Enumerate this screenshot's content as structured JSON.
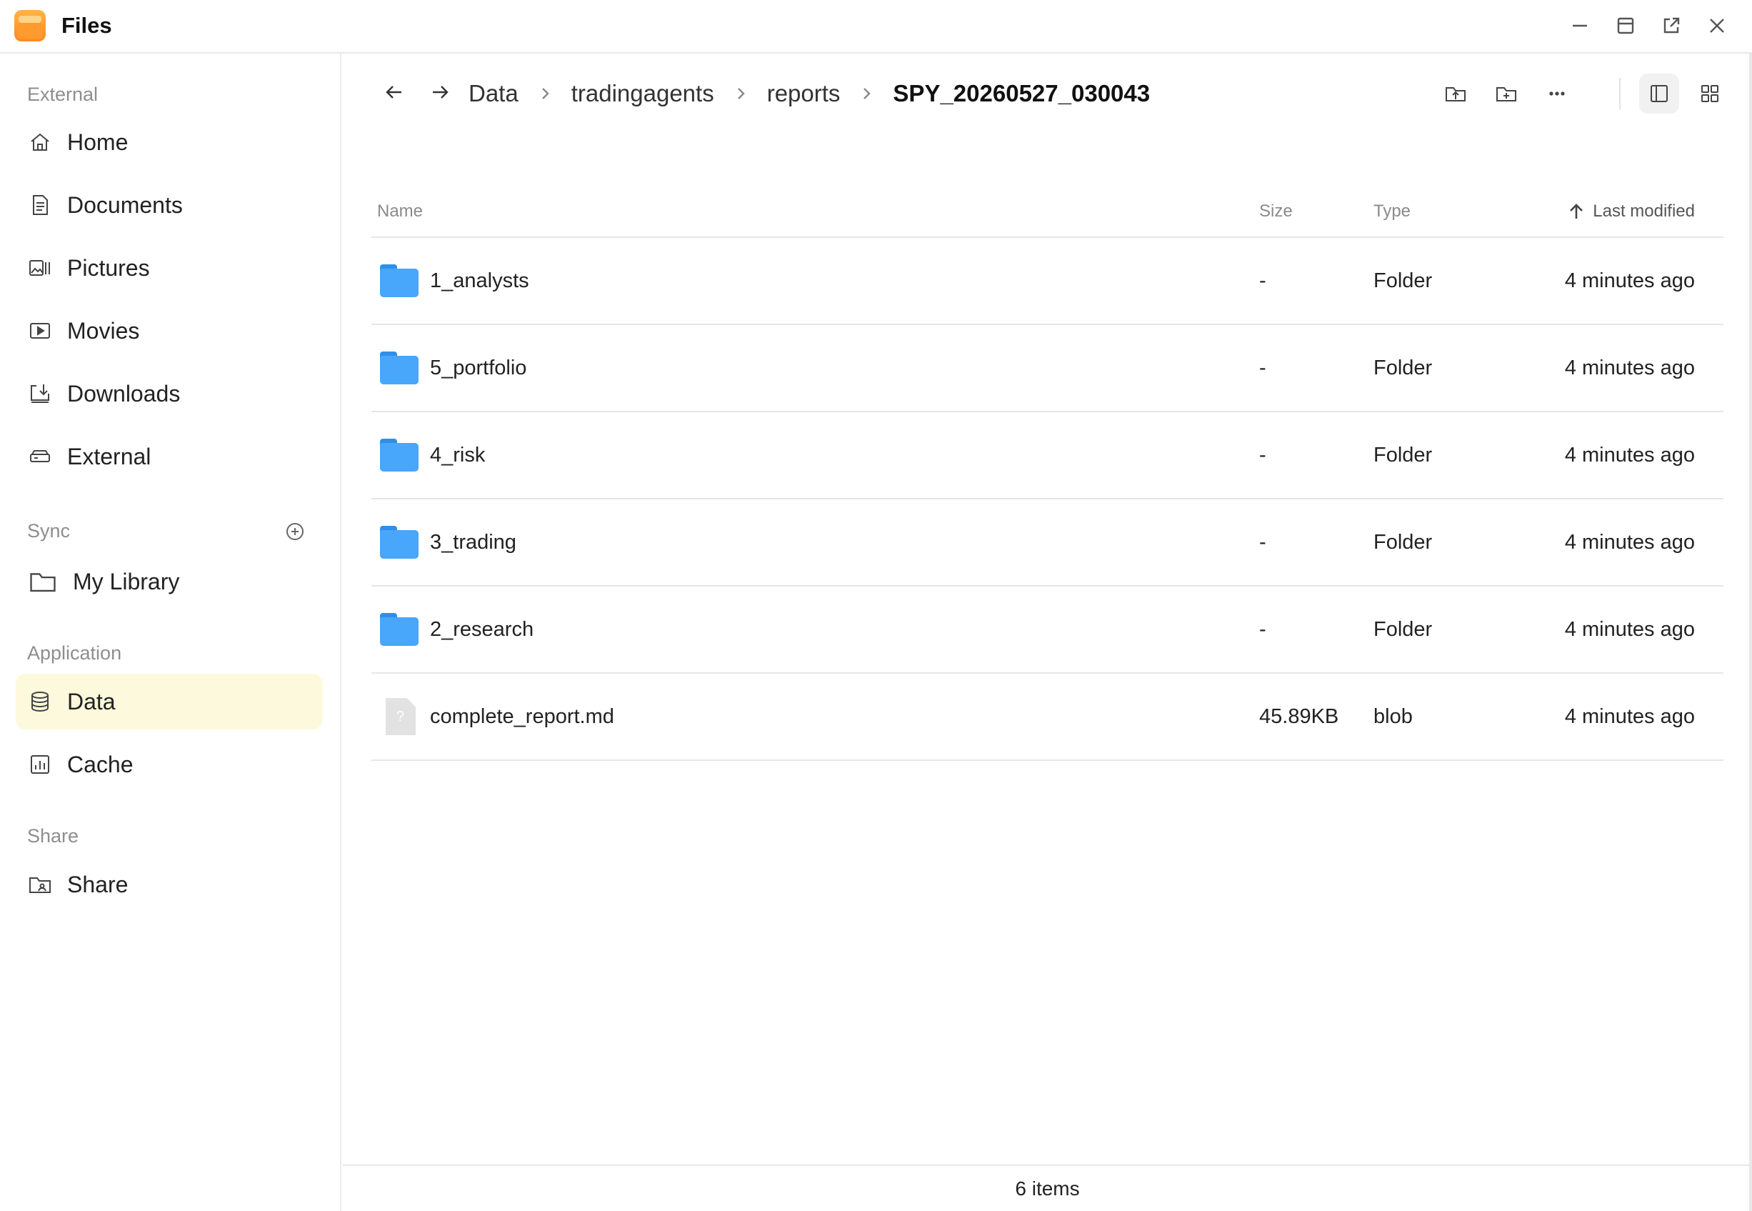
{
  "window": {
    "title": "Files"
  },
  "sidebar": {
    "sections": {
      "external": "External",
      "sync": "Sync",
      "application": "Application",
      "share": "Share"
    },
    "items": {
      "home": "Home",
      "documents": "Documents",
      "pictures": "Pictures",
      "movies": "Movies",
      "downloads": "Downloads",
      "external": "External",
      "my_library": "My Library",
      "data": "Data",
      "cache": "Cache",
      "share": "Share"
    },
    "active_item": "Data",
    "active_color": "#fdf9dc"
  },
  "breadcrumb": {
    "items": [
      "Data",
      "tradingagents",
      "reports",
      "SPY_20260527_030043"
    ]
  },
  "table": {
    "headers": {
      "name": "Name",
      "size": "Size",
      "type": "Type",
      "modified": "Last modified"
    },
    "sort": {
      "column": "Last modified",
      "direction": "ascending"
    },
    "rows": [
      {
        "name": "1_analysts",
        "size": "-",
        "type": "Folder",
        "modified": "4 minutes ago",
        "icon": "folder-icon"
      },
      {
        "name": "5_portfolio",
        "size": "-",
        "type": "Folder",
        "modified": "4 minutes ago",
        "icon": "folder-icon"
      },
      {
        "name": "4_risk",
        "size": "-",
        "type": "Folder",
        "modified": "4 minutes ago",
        "icon": "folder-icon"
      },
      {
        "name": "3_trading",
        "size": "-",
        "type": "Folder",
        "modified": "4 minutes ago",
        "icon": "folder-icon"
      },
      {
        "name": "2_research",
        "size": "-",
        "type": "Folder",
        "modified": "4 minutes ago",
        "icon": "folder-icon"
      },
      {
        "name": "complete_report.md",
        "size": "45.89KB",
        "type": "blob",
        "modified": "4 minutes ago",
        "icon": "unknown-file-icon"
      }
    ]
  },
  "status": {
    "count": "6 items"
  },
  "colors": {
    "folder": "#48a6fb",
    "app_accent": "#ff8a1f"
  }
}
